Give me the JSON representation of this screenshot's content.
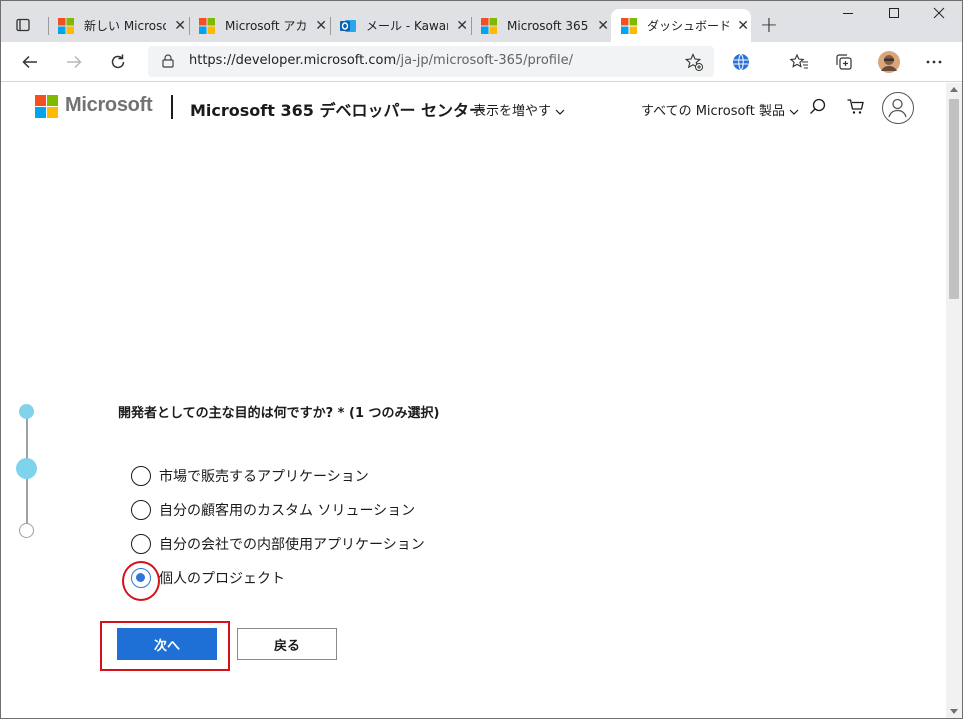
{
  "browser": {
    "tabs": [
      {
        "title": "新しい Microso",
        "icon": "microsoft-favicon"
      },
      {
        "title": "Microsoft アカ",
        "icon": "microsoft-favicon"
      },
      {
        "title": "メール - Kawam",
        "icon": "outlook-favicon"
      },
      {
        "title": "Microsoft 365",
        "icon": "microsoft-favicon"
      },
      {
        "title": "ダッシュボード -",
        "icon": "microsoft-favicon",
        "active": true
      }
    ],
    "url_host": "https://developer.microsoft.com",
    "url_path": "/ja-jp/microsoft-365/profile/"
  },
  "header": {
    "brand": "Microsoft",
    "site_title": "Microsoft 365 デベロッパー センター",
    "more_menu": "表示を増やす",
    "all_products": "すべての Microsoft 製品"
  },
  "stepper": {
    "steps_total": 3,
    "current_step": 2
  },
  "form": {
    "question": "開発者としての主な目的は何ですか? * (1 つのみ選択)",
    "options": [
      {
        "label": "市場で販売するアプリケーション",
        "selected": false
      },
      {
        "label": "自分の顧客用のカスタム ソリューション",
        "selected": false
      },
      {
        "label": "自分の会社での内部使用アプリケーション",
        "selected": false
      },
      {
        "label": "個人のプロジェクト",
        "selected": true
      }
    ],
    "next_label": "次へ",
    "back_label": "戻る"
  },
  "colors": {
    "accent": "#1e6fd6",
    "radio_checked": "#2f76d8",
    "step_active": "#7fd3ea",
    "annotation_red": "#d4121c"
  }
}
